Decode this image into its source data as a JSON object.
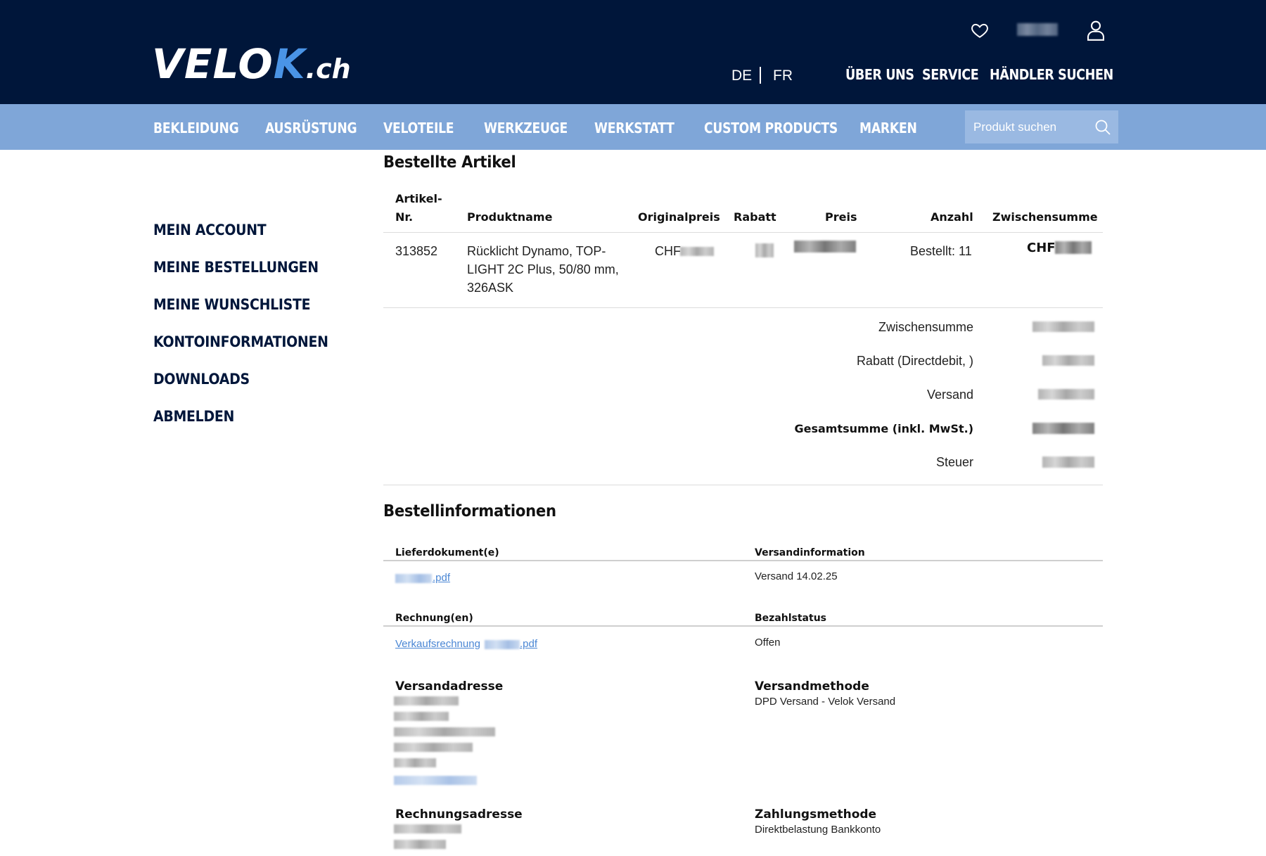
{
  "header": {
    "logo_text_main": "VELO",
    "logo_text_k": "K",
    "logo_text_tld": ".ch",
    "wishlist_icon": "heart-icon",
    "account_icon": "user-icon",
    "languages": [
      "DE",
      "FR"
    ],
    "nav": [
      "ÜBER UNS",
      "SERVICE",
      "HÄNDLER SUCHEN"
    ]
  },
  "categories": [
    "BEKLEIDUNG",
    "AUSRÜSTUNG",
    "VELOTEILE",
    "WERKZEUGE",
    "WERKSTATT",
    "CUSTOM PRODUCTS",
    "MARKEN"
  ],
  "search": {
    "placeholder": "Produkt suchen",
    "icon": "search-icon"
  },
  "sidebar": [
    "MEIN ACCOUNT",
    "MEINE BESTELLUNGEN",
    "MEINE WUNSCHLISTE",
    "KONTOINFORMATIONEN",
    "DOWNLOADS",
    "ABMELDEN"
  ],
  "ordered_items": {
    "title": "Bestellte Artikel",
    "columns": {
      "sku_line1": "Artikel-",
      "sku_line2": "Nr.",
      "name": "Produktname",
      "original_price": "Originalpreis",
      "discount": "Rabatt",
      "price": "Preis",
      "qty": "Anzahl",
      "subtotal": "Zwischensumme"
    },
    "rows": [
      {
        "sku": "313852",
        "name_lines": [
          "Rücklicht Dynamo, TOP-",
          "LIGHT 2C Plus, 50/80 mm,",
          "326ASK"
        ],
        "original_price_prefix": "CHF",
        "qty": "Bestellt: 11",
        "subtotal_prefix": "CHF"
      }
    ],
    "totals": [
      "Zwischensumme",
      "Rabatt (Directdebit, )",
      "Versand",
      "Gesamtsumme (inkl. MwSt.)",
      "Steuer"
    ]
  },
  "order_info": {
    "title": "Bestellinformationen",
    "delivery_docs_label": "Lieferdokument(e)",
    "delivery_doc_suffix": ".pdf",
    "shipping_info_label": "Versandinformation",
    "shipping_info_value": "Versand 14.02.25",
    "invoices_label": "Rechnung(en)",
    "invoice_link_prefix": "Verkaufsrechnung",
    "invoice_link_suffix": ".pdf",
    "payment_status_label": "Bezahlstatus",
    "payment_status_value": "Offen",
    "shipping_address_label": "Versandadresse",
    "shipping_method_label": "Versandmethode",
    "shipping_method_value": "DPD Versand - Velok Versand",
    "billing_address_label": "Rechnungsadresse",
    "payment_method_label": "Zahlungsmethode",
    "payment_method_value": "Direktbelastung Bankkonto"
  },
  "colors": {
    "header_bg": "#00163a",
    "category_bar_bg": "#7fa6d8",
    "logo_accent": "#4a94e6",
    "link": "#4a86d4"
  }
}
